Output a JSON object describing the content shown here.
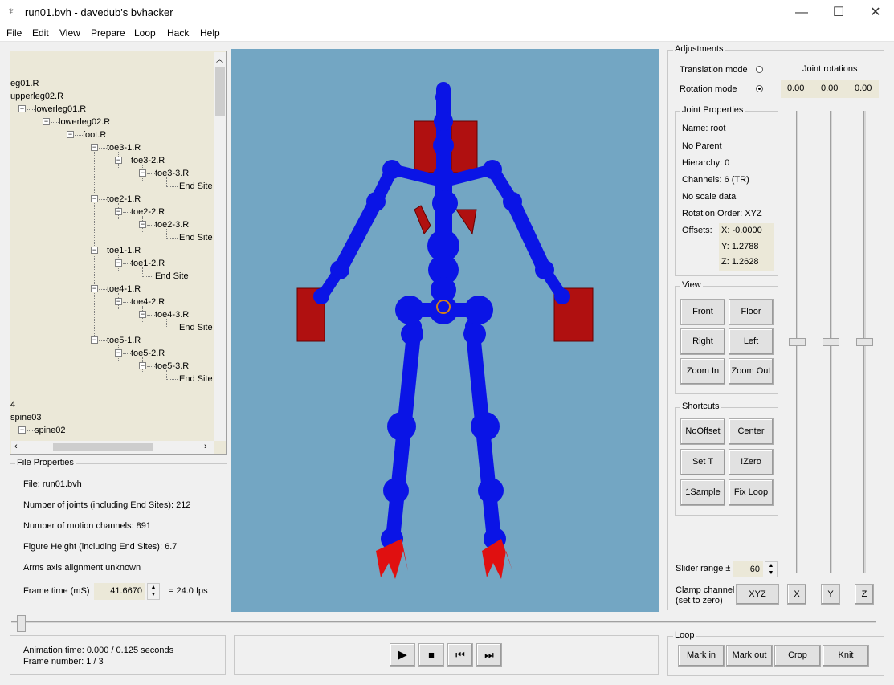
{
  "window": {
    "title": "run01.bvh - davedub's bvhacker",
    "minimize_glyph": "—",
    "maximize_glyph": "☐",
    "close_glyph": "✕"
  },
  "menu": [
    "File",
    "Edit",
    "View",
    "Prepare",
    "Loop",
    "Hack",
    "Help"
  ],
  "tree": {
    "rows": [
      "eg01.R",
      "upperleg02.R",
      "lowerleg01.R",
      "lowerleg02.R",
      "foot.R",
      "toe3-1.R",
      "toe3-2.R",
      "toe3-3.R",
      "End Site",
      "toe2-1.R",
      "toe2-2.R",
      "toe2-3.R",
      "End Site",
      "toe1-1.R",
      "toe1-2.R",
      "End Site",
      "toe4-1.R",
      "toe4-2.R",
      "toe4-3.R",
      "End Site",
      "toe5-1.R",
      "toe5-2.R",
      "toe5-3.R",
      "End Site",
      "4",
      "spine03",
      "spine02"
    ]
  },
  "file_properties": {
    "title": "File Properties",
    "file": "File: run01.bvh",
    "joints": "Number of joints (including End Sites): 212",
    "channels": "Number of motion channels: 891",
    "height": "Figure Height (including End Sites): 6.7",
    "arms": "Arms axis alignment unknown",
    "frame_time_label": "Frame time (mS)",
    "frame_time_value": "41.6670",
    "fps": "=  24.0 fps"
  },
  "animation": {
    "time": "Animation time: 0.000 / 0.125 seconds",
    "frame": "Frame number: 1 / 3",
    "timeline_position": 0.0
  },
  "adjustments": {
    "title": "Adjustments",
    "translation_mode": "Translation mode",
    "rotation_mode": "Rotation mode",
    "joint_rotations": "Joint rotations",
    "rot_x": "0.00",
    "rot_y": "0.00",
    "rot_z": "0.00",
    "slider_range_label": "Slider range ±",
    "slider_range_value": "60",
    "clamp_label_1": "Clamp channel",
    "clamp_label_2": "(set to zero)",
    "xyz_btn": "XYZ",
    "x_btn": "X",
    "y_btn": "Y",
    "z_btn": "Z"
  },
  "joint_properties": {
    "title": "Joint Properties",
    "name": "Name: root",
    "parent": "No Parent",
    "hierarchy": "Hierarchy: 0",
    "channels": "Channels: 6 (TR)",
    "scale": "No scale data",
    "rotation_order": "Rotation Order: XYZ",
    "offsets_label": "Offsets:",
    "off_x": "X:  -0.0000",
    "off_y": "Y:  1.2788",
    "off_z": "Z:  1.2628"
  },
  "view": {
    "title": "View",
    "front": "Front",
    "floor": "Floor",
    "right": "Right",
    "left": "Left",
    "zoom_in": "Zoom In",
    "zoom_out": "Zoom Out"
  },
  "shortcuts": {
    "title": "Shortcuts",
    "nooffset": "NoOffset",
    "center": "Center",
    "set_t": "Set T",
    "zero": "!Zero",
    "one_sample": "1Sample",
    "fix_loop": "Fix Loop"
  },
  "loop": {
    "title": "Loop",
    "mark_in": "Mark in",
    "mark_out": "Mark out",
    "crop": "Crop",
    "knit": "Knit"
  },
  "transport": {
    "play": "▶",
    "stop": "■",
    "first": "⏮",
    "last": "⏭"
  },
  "colors": {
    "viewport_bg": "#73a6c3",
    "skeleton_blue": "#0a14e6",
    "marker_red": "#b01010",
    "tree_bg": "#ebe8d8"
  }
}
